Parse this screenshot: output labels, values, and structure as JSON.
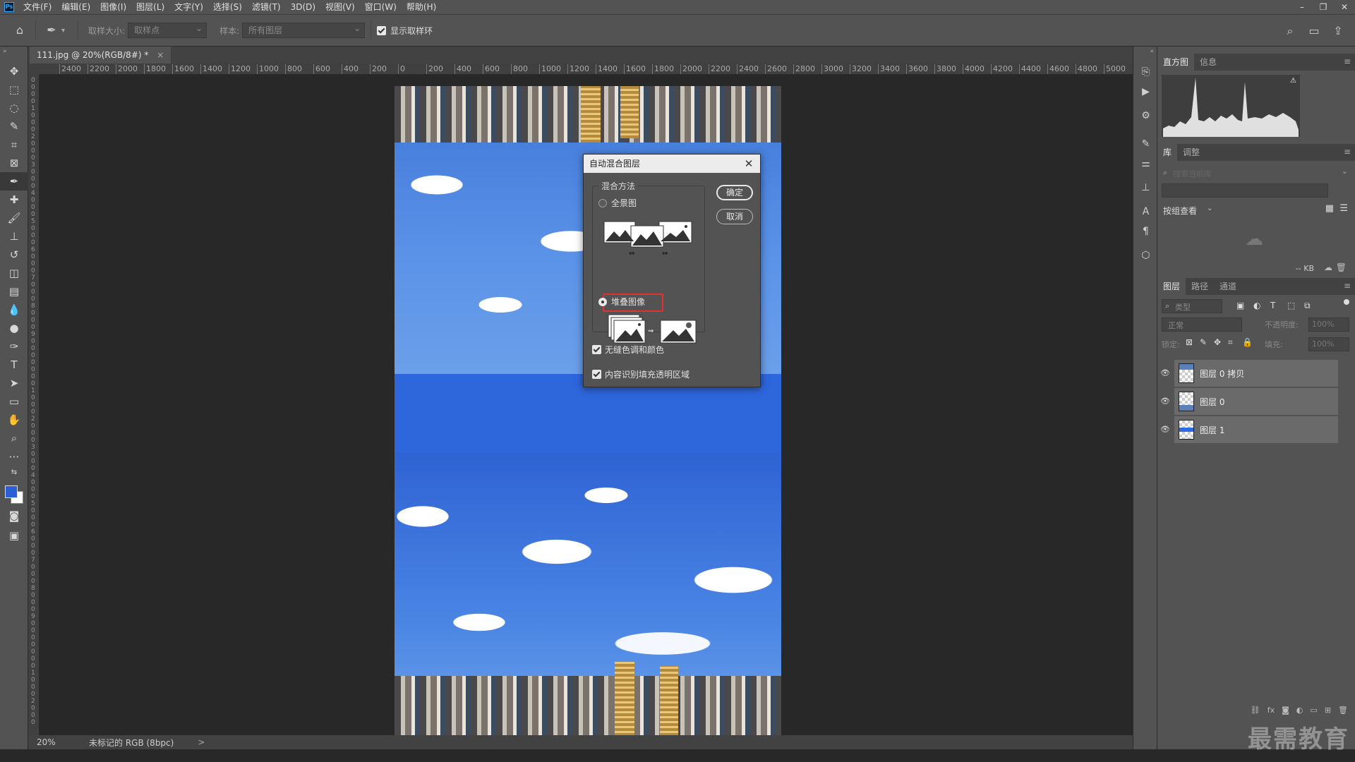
{
  "menu": {
    "items": [
      "文件(F)",
      "编辑(E)",
      "图像(I)",
      "图层(L)",
      "文字(Y)",
      "选择(S)",
      "滤镜(T)",
      "3D(D)",
      "视图(V)",
      "窗口(W)",
      "帮助(H)"
    ],
    "window_controls": [
      "–",
      "❐",
      "✕"
    ]
  },
  "options_bar": {
    "sample_size_label": "取样大小:",
    "sample_size_value": "取样点",
    "sample_label": "样本:",
    "sample_value": "所有图层",
    "show_ring_label": "显示取样环"
  },
  "document": {
    "tab_title": "111.jpg @ 20%(RGB/8#) *",
    "tab_close": "×",
    "ruler_h_labels": [
      "2400",
      "2200",
      "2000",
      "1800",
      "1600",
      "1400",
      "1200",
      "1000",
      "800",
      "600",
      "400",
      "200",
      "0",
      "200",
      "400",
      "600",
      "800",
      "1000",
      "1200",
      "1400",
      "1600",
      "1800",
      "2000",
      "2200",
      "2400",
      "2600",
      "2800",
      "3000",
      "3200",
      "3400",
      "3600",
      "3800",
      "4000",
      "4200",
      "4400",
      "4600",
      "4800",
      "5000"
    ],
    "zoom": "20%",
    "profile": "未标记的 RGB (8bpc)",
    "status_arrow": ">"
  },
  "dialog": {
    "title": "自动混合图层",
    "close": "✕",
    "group_label": "混合方法",
    "option_panorama": "全景图",
    "option_stack": "堆叠图像",
    "seamless_tones": "无缝色调和颜色",
    "content_aware_fill": "内容识别填充透明区域",
    "ok": "确定",
    "cancel": "取消"
  },
  "panels": {
    "histogram_tabs": [
      "直方图",
      "信息"
    ],
    "library_tabs": [
      "库",
      "调整"
    ],
    "library_search_placeholder": "搜索当前库",
    "library_view": "按组查看",
    "library_size": "-- KB",
    "layers_tabs": [
      "图层",
      "路径",
      "通道"
    ],
    "layers_filter": "类型",
    "blend_mode": "正常",
    "opacity_label": "不透明度:",
    "opacity_value": "100%",
    "lock_label": "锁定:",
    "fill_label": "填充:",
    "fill_value": "100%",
    "layers": [
      {
        "name": "图层 0 拷贝"
      },
      {
        "name": "图层 0"
      },
      {
        "name": "图层 1"
      }
    ]
  },
  "watermark": "最需教育",
  "colors": {
    "foreground": "#2a5fd6",
    "background": "#ffffff",
    "highlight": "#e03030"
  }
}
